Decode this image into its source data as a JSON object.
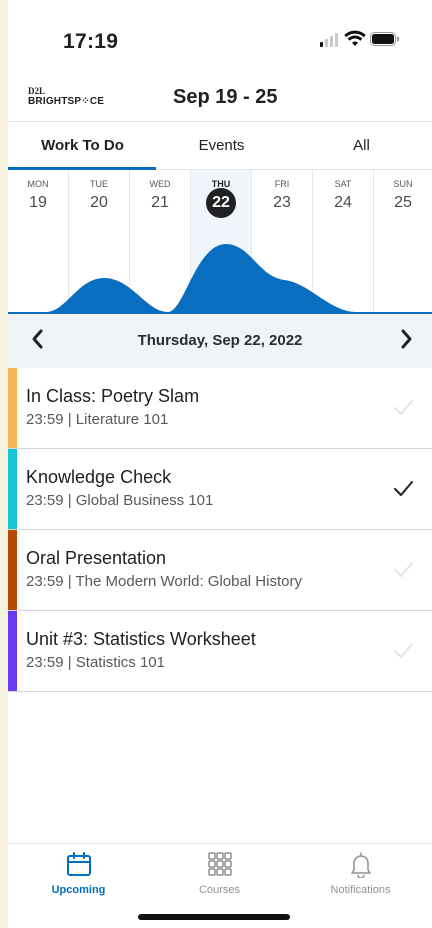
{
  "status_bar": {
    "time": "17:19"
  },
  "header": {
    "logo_small": "D2L",
    "logo_brand": "BRIGHTSP⁘CE",
    "date_range": "Sep 19 - 25"
  },
  "tabs": [
    {
      "label": "Work To Do",
      "active": true
    },
    {
      "label": "Events",
      "active": false
    },
    {
      "label": "All",
      "active": false
    }
  ],
  "week": [
    {
      "name": "MON",
      "num": "19"
    },
    {
      "name": "TUE",
      "num": "20"
    },
    {
      "name": "WED",
      "num": "21"
    },
    {
      "name": "THU",
      "num": "22",
      "selected": true
    },
    {
      "name": "FRI",
      "num": "23"
    },
    {
      "name": "SAT",
      "num": "24"
    },
    {
      "name": "SUN",
      "num": "25"
    }
  ],
  "date_nav": {
    "label": "Thursday, Sep 22, 2022",
    "prev": "‹",
    "next": "›"
  },
  "items": [
    {
      "title": "In Class: Poetry Slam",
      "subtitle": "23:59 | Literature 101",
      "color": "#f6b555",
      "done": false
    },
    {
      "title": "Knowledge Check",
      "subtitle": "23:59 | Global Business 101",
      "color": "#19c4d8",
      "done": true
    },
    {
      "title": "Oral Presentation",
      "subtitle": "23:59 | The Modern World: Global History",
      "color": "#b54a05",
      "done": false
    },
    {
      "title": "Unit #3: Statistics Worksheet",
      "subtitle": "23:59 | Statistics 101",
      "color": "#6a3cf0",
      "done": false
    }
  ],
  "bottom_nav": [
    {
      "label": "Upcoming",
      "icon": "calendar-icon",
      "active": true
    },
    {
      "label": "Courses",
      "icon": "grid-icon",
      "active": false
    },
    {
      "label": "Notifications",
      "icon": "bell-icon",
      "active": false
    }
  ],
  "colors": {
    "accent": "#006fbf",
    "wave": "#0a6ec0",
    "check_done": "#202122",
    "check_todo": "#e3e5e7"
  }
}
